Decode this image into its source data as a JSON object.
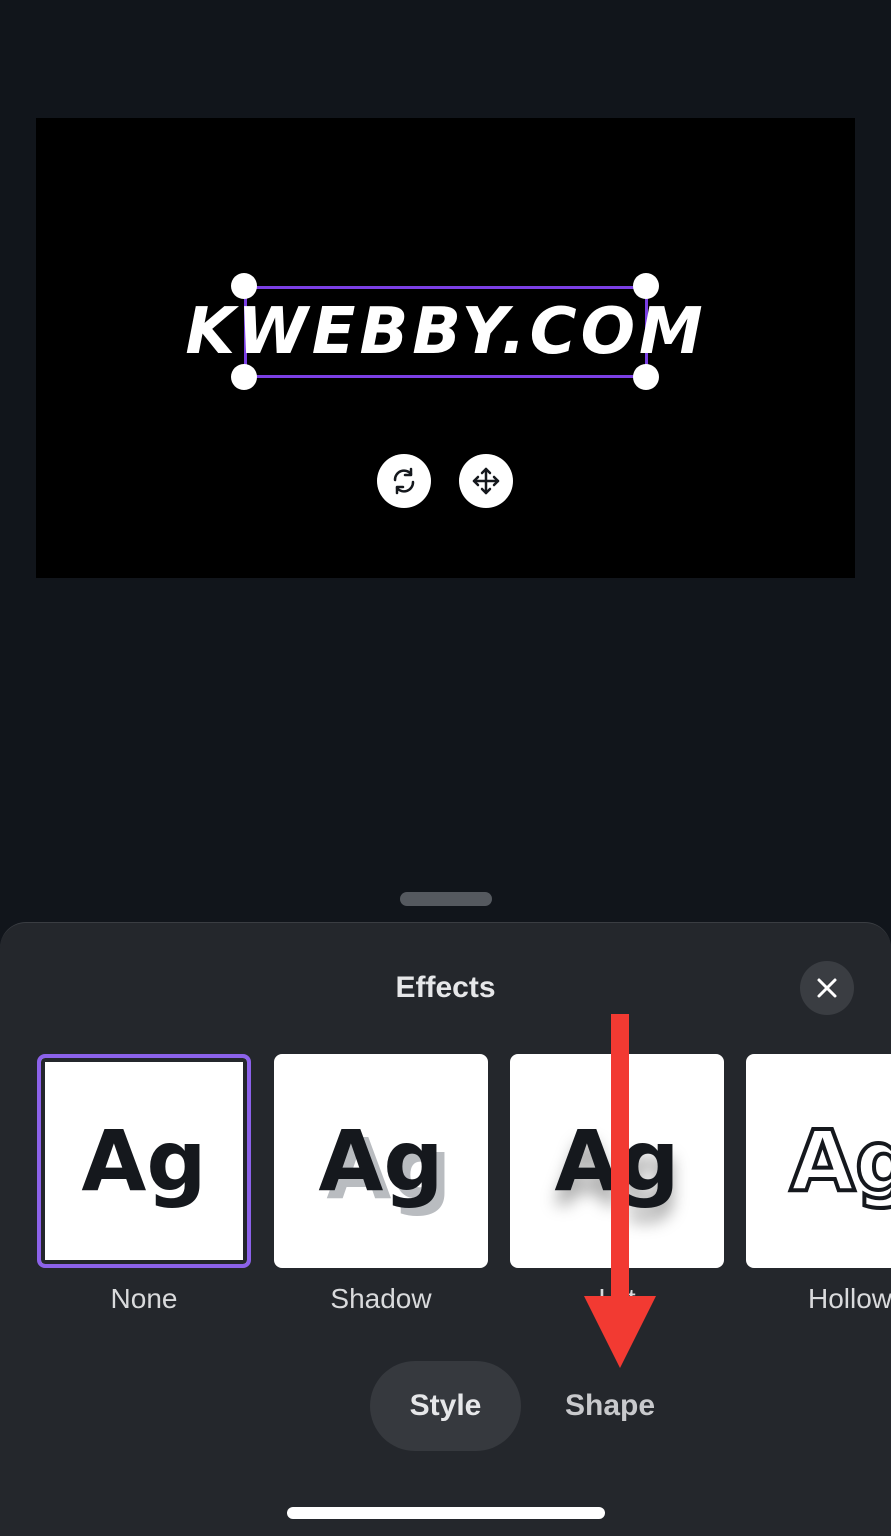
{
  "canvas": {
    "text": "KWEBBY.COM",
    "rotate_icon": "rotate-icon",
    "move_icon": "move-icon"
  },
  "effects_panel": {
    "title": "Effects",
    "close_icon": "close-icon",
    "options": [
      {
        "label": "None",
        "preview": "Ag",
        "selected": true
      },
      {
        "label": "Shadow",
        "preview": "Ag",
        "selected": false
      },
      {
        "label": "Lift",
        "preview": "Ag",
        "selected": false
      },
      {
        "label": "Hollow",
        "preview": "Ag",
        "selected": false
      }
    ],
    "tabs": [
      {
        "label": "Style",
        "active": true
      },
      {
        "label": "Shape",
        "active": false
      }
    ]
  },
  "annotation": {
    "arrow_color": "#f23a32",
    "arrow_direction": "down"
  },
  "colors": {
    "selection_accent": "#7b3fe4",
    "panel_background": "#24272c",
    "app_background": "#11151b"
  }
}
